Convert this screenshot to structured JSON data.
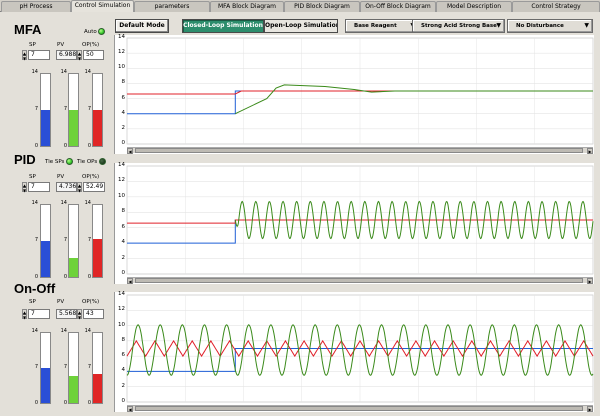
{
  "tabs": [
    "pH Process",
    "Control Simulation",
    "parameters",
    "MFA Block Diagram",
    "PID Block Diagram",
    "On-Off Block Diagram",
    "Model Description",
    "Control Strategy"
  ],
  "active_tab": "Control Simulation",
  "toolbar": {
    "default_mode": "Default Mode",
    "closed_loop": "Closed-Loop Simulation",
    "open_loop": "Open-Loop Simulation",
    "reagent": "Base Reagent",
    "acid_base": "Strong Acid Strong Base",
    "disturbance": "No Disturbance"
  },
  "sections": [
    {
      "title": "MFA",
      "indicator": {
        "label": "Auto",
        "state": "on"
      },
      "sp_label": "SP",
      "pv_label": "PV",
      "op_label": "OP(%)",
      "sp": "7",
      "pv": "6.988",
      "op": "50",
      "levels": {
        "sp": 7,
        "pv": 6.988,
        "op": 7
      },
      "ticks": [
        "14",
        "7",
        "0"
      ]
    },
    {
      "title": "PID",
      "tie_sps": {
        "label": "Tie SPs",
        "state": "on"
      },
      "tie_ops": {
        "label": "Tie OPs",
        "state": "off"
      },
      "sp_label": "SP",
      "pv_label": "PV",
      "op_label": "OP(%)",
      "sp": "7",
      "pv": "4.736",
      "op": "52.49",
      "levels": {
        "sp": 7,
        "pv": 3.7,
        "op": 7.3
      },
      "ticks": [
        "14",
        "7",
        "0"
      ]
    },
    {
      "title": "On-Off",
      "sp_label": "SP",
      "pv_label": "PV",
      "op_label": "OP(%)",
      "sp": "7",
      "pv": "5.568",
      "op": "43",
      "levels": {
        "sp": 7,
        "pv": 5.5,
        "op": 5.8
      },
      "ticks": [
        "14",
        "7",
        "0"
      ]
    }
  ],
  "chart_ticks": [
    "14",
    "12",
    "10",
    "8",
    "6",
    "4",
    "2",
    "0"
  ],
  "colors": {
    "sp": "#1f5fd6",
    "pv": "#3a8a1a",
    "op": "#e0202a",
    "blue_bar": "#2a4fd6",
    "green_bar": "#6ed23a",
    "red_bar": "#e02626"
  },
  "chart_data": [
    {
      "type": "line",
      "ylim": [
        0,
        14
      ],
      "series": [
        {
          "values": [
            [
              0,
              4
            ],
            [
              93,
              4
            ],
            [
              93,
              7
            ],
            [
              400,
              7
            ]
          ]
        },
        {
          "values": [
            [
              0,
              6.6
            ],
            [
              93,
              6.6
            ],
            [
              98,
              7
            ],
            [
              400,
              7
            ]
          ]
        },
        {
          "values": [
            [
              93,
              4
            ],
            [
              120,
              6
            ],
            [
              128,
              7.4
            ],
            [
              135,
              7.8
            ],
            [
              170,
              7.6
            ],
            [
              195,
              7.2
            ],
            [
              210,
              6.85
            ],
            [
              230,
              7
            ],
            [
              400,
              7
            ]
          ]
        }
      ]
    },
    {
      "type": "line",
      "ylim": [
        0,
        14
      ],
      "series": [
        {
          "values": [
            [
              0,
              4
            ],
            [
              93,
              4
            ],
            [
              93,
              7
            ],
            [
              400,
              7
            ]
          ]
        },
        {
          "values": [
            [
              0,
              6.6
            ],
            [
              93,
              6.6
            ],
            [
              93,
              7
            ],
            [
              400,
              7
            ]
          ]
        },
        {
          "oscillation": {
            "start": 93,
            "center": 7,
            "amplitude": 2.4,
            "period": 11.7
          }
        }
      ]
    },
    {
      "type": "line",
      "ylim": [
        0,
        14
      ],
      "series": [
        {
          "values": [
            [
              0,
              4
            ],
            [
              93,
              4
            ],
            [
              93,
              7
            ],
            [
              400,
              7
            ]
          ]
        },
        {
          "sawtooth": {
            "center": 7,
            "amplitude": 1,
            "period": 16
          }
        },
        {
          "oscillation": {
            "start": 0,
            "center": 6.8,
            "amplitude": 3.3,
            "period": 19
          }
        }
      ]
    }
  ]
}
